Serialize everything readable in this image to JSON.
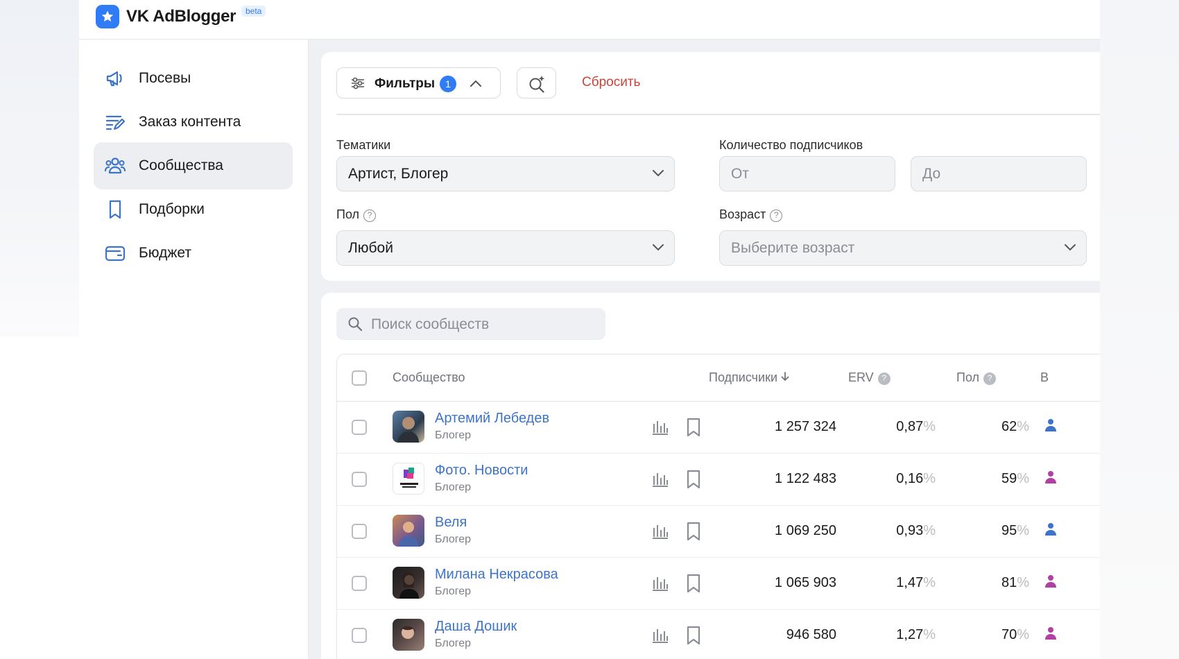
{
  "app": {
    "title": "VK AdBlogger",
    "badge": "beta"
  },
  "sidebar": {
    "items": [
      {
        "label": "Посевы",
        "icon": "megaphone-icon"
      },
      {
        "label": "Заказ контента",
        "icon": "content-order-icon"
      },
      {
        "label": "Сообщества",
        "icon": "communities-icon",
        "active": true
      },
      {
        "label": "Подборки",
        "icon": "bookmark-icon"
      },
      {
        "label": "Бюджет",
        "icon": "wallet-icon"
      }
    ]
  },
  "filters": {
    "button_label": "Фильтры",
    "count": "1",
    "reset_label": "Сбросить",
    "topics": {
      "label": "Тематики",
      "value": "Артист, Блогер"
    },
    "subscribers": {
      "label": "Количество подписчиков",
      "from_placeholder": "От",
      "to_placeholder": "До"
    },
    "gender": {
      "label": "Пол",
      "value": "Любой"
    },
    "age": {
      "label": "Возраст",
      "placeholder": "Выберите возраст"
    }
  },
  "search": {
    "placeholder": "Поиск сообществ"
  },
  "table": {
    "columns": {
      "community": "Сообщество",
      "subscribers": "Подписчики",
      "erv": "ERV",
      "gender": "Пол",
      "next": "В"
    },
    "rows": [
      {
        "name": "Артемий Лебедев",
        "category": "Блогер",
        "subscribers": "1 257 324",
        "erv": "0,87",
        "gender_pct": "62",
        "gender": "male"
      },
      {
        "name": "Фото. Новости",
        "category": "Блогер",
        "subscribers": "1 122 483",
        "erv": "0,16",
        "gender_pct": "59",
        "gender": "female"
      },
      {
        "name": "Веля",
        "category": "Блогер",
        "subscribers": "1 069 250",
        "erv": "0,93",
        "gender_pct": "95",
        "gender": "male"
      },
      {
        "name": "Милана Некрасова",
        "category": "Блогер",
        "subscribers": "1 065 903",
        "erv": "1,47",
        "gender_pct": "81",
        "gender": "female"
      },
      {
        "name": "Даша Дошик",
        "category": "Блогер",
        "subscribers": "946 580",
        "erv": "1,27",
        "gender_pct": "70",
        "gender": "female"
      }
    ]
  },
  "colors": {
    "accent": "#2f7cf6",
    "link": "#3d74c7",
    "reset": "#c6463a",
    "male": "#3d74c7",
    "female": "#b43fa3"
  }
}
